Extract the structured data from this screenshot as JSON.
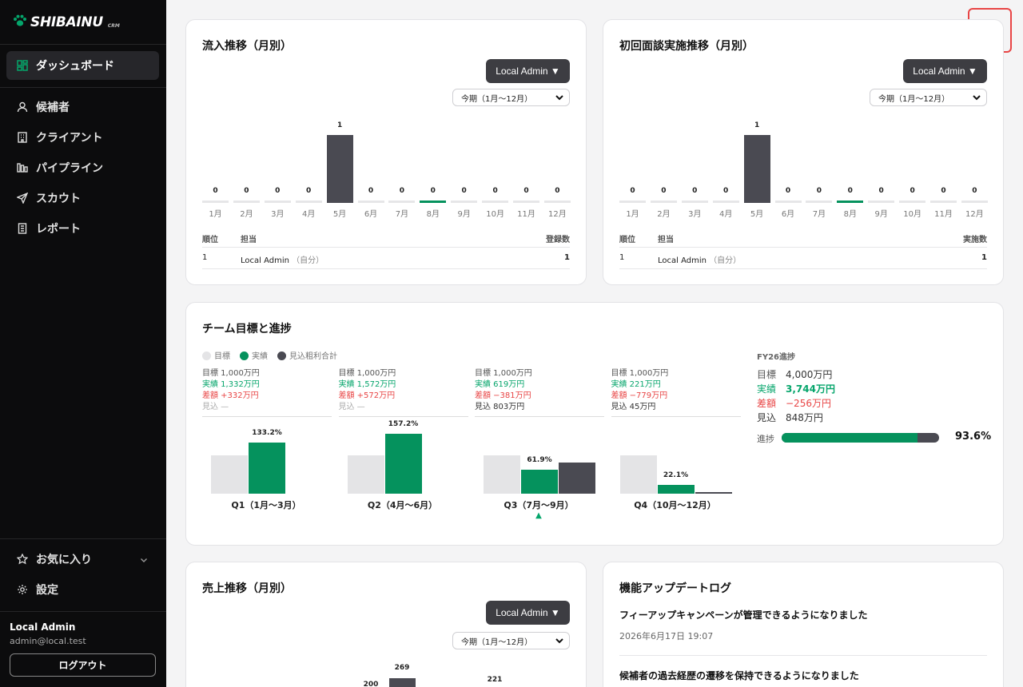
{
  "sidebar": {
    "logo": "SHIBAINU",
    "logo_sub": "CRM",
    "nav": [
      {
        "label": "ダッシュボード",
        "icon": "dashboard-icon"
      },
      {
        "label": "候補者",
        "icon": "person-icon"
      },
      {
        "label": "クライアント",
        "icon": "building-icon"
      },
      {
        "label": "パイプライン",
        "icon": "pipeline-icon"
      },
      {
        "label": "スカウト",
        "icon": "send-icon"
      },
      {
        "label": "レポート",
        "icon": "report-icon"
      }
    ],
    "favorites": "お気に入り",
    "settings": "設定",
    "user_name": "Local Admin",
    "user_email": "admin@local.test",
    "logout": "ログアウト"
  },
  "inflow": {
    "title": "流入推移（月別）",
    "admin": "Local Admin ▼",
    "period": "今期（1月〜12月）",
    "rank_headers": [
      "順位",
      "担当",
      "登録数"
    ],
    "rank_rows": [
      {
        "rank": "1",
        "name": "Local Admin",
        "note": "（自分）",
        "value": "1"
      }
    ]
  },
  "interview": {
    "title": "初回面談実施推移（月別）",
    "admin": "Local Admin ▼",
    "period": "今期（1月〜12月）",
    "rank_headers": [
      "順位",
      "担当",
      "実施数"
    ],
    "rank_rows": [
      {
        "rank": "1",
        "name": "Local Admin",
        "note": "（自分）",
        "value": "1"
      }
    ]
  },
  "team": {
    "title": "チーム目標と進捗",
    "legend": [
      "目標",
      "実績",
      "見込粗利合計"
    ],
    "quarters": [
      {
        "goal": "目標 1,000万円",
        "actual": "実績 1,332万円",
        "diff": "差額 +332万円",
        "forecast": "見込 —",
        "pct": "133.2%",
        "label": "Q1（1月〜3月）"
      },
      {
        "goal": "目標 1,000万円",
        "actual": "実績 1,572万円",
        "diff": "差額 +572万円",
        "forecast": "見込 —",
        "pct": "157.2%",
        "label": "Q2（4月〜6月）"
      },
      {
        "goal": "目標 1,000万円",
        "actual": "実績 619万円",
        "diff": "差額 −381万円",
        "forecast": "見込 803万円",
        "pct": "61.9%",
        "label": "Q3（7月〜9月）"
      },
      {
        "goal": "目標 1,000万円",
        "actual": "実績 221万円",
        "diff": "差額 −779万円",
        "forecast": "見込 45万円",
        "pct": "22.1%",
        "label": "Q4（10月〜12月）"
      }
    ],
    "current_marker": "▲",
    "fy": {
      "title": "FY26進捗",
      "goal_k": "目標",
      "goal_v": "4,000万円",
      "actual_k": "実績",
      "actual_v": "3,744万円",
      "diff_k": "差額",
      "diff_v": "−256万円",
      "forecast_k": "見込",
      "forecast_v": "848万円",
      "progress_k": "進捗",
      "progress_pct": "93.6%",
      "progress_value": 0.936
    }
  },
  "sales": {
    "title": "売上推移（月別）",
    "admin": "Local Admin ▼",
    "period": "今期（1月〜12月）",
    "visible_values": [
      "200",
      "269",
      "221"
    ]
  },
  "updates": {
    "title": "機能アップデートログ",
    "items": [
      {
        "title": "フィーアップキャンペーンが管理できるようになりました",
        "date": "2026年6月17日 19:07"
      },
      {
        "title": "候補者の過去経歴の遷移を保持できるようになりました",
        "date": ""
      }
    ]
  },
  "colors": {
    "actual": "#05925d",
    "forecast": "#4a4a52",
    "goal": "#e4e4e6",
    "alert": "#e84545"
  },
  "chart_data": [
    {
      "type": "bar",
      "title": "流入推移（月別）",
      "categories": [
        "1月",
        "2月",
        "3月",
        "4月",
        "5月",
        "6月",
        "7月",
        "8月",
        "9月",
        "10月",
        "11月",
        "12月"
      ],
      "values": [
        0,
        0,
        0,
        0,
        1,
        0,
        0,
        0,
        0,
        0,
        0,
        0
      ],
      "ylim": [
        0,
        1
      ]
    },
    {
      "type": "bar",
      "title": "初回面談実施推移（月別）",
      "categories": [
        "1月",
        "2月",
        "3月",
        "4月",
        "5月",
        "6月",
        "7月",
        "8月",
        "9月",
        "10月",
        "11月",
        "12月"
      ],
      "values": [
        0,
        0,
        0,
        0,
        1,
        0,
        0,
        0,
        0,
        0,
        0,
        0
      ],
      "ylim": [
        0,
        1
      ]
    },
    {
      "type": "bar",
      "title": "チーム目標と進捗",
      "categories": [
        "Q1（1月〜3月）",
        "Q2（4月〜6月）",
        "Q3（7月〜9月）",
        "Q4（10月〜12月）"
      ],
      "series": [
        {
          "name": "目標",
          "values": [
            1000,
            1000,
            1000,
            1000
          ]
        },
        {
          "name": "実績",
          "values": [
            1332,
            1572,
            619,
            221
          ]
        },
        {
          "name": "見込粗利合計",
          "values": [
            0,
            0,
            803,
            45
          ]
        }
      ]
    }
  ]
}
